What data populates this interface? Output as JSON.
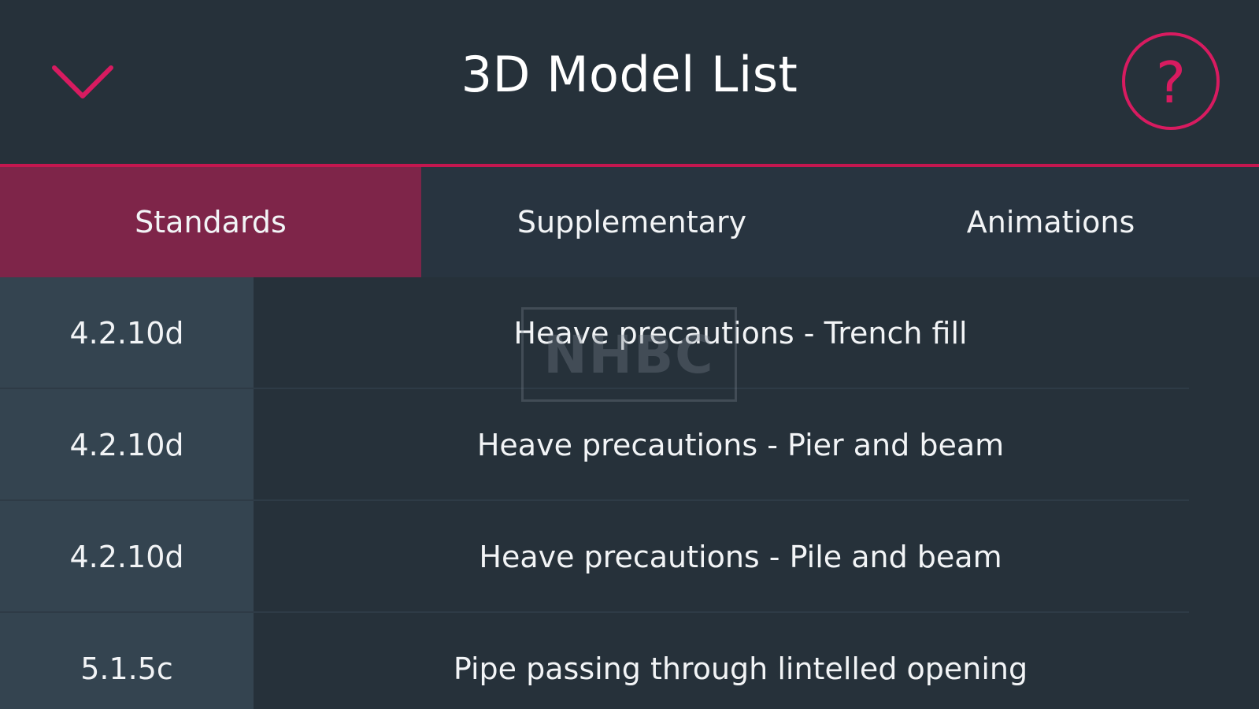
{
  "header": {
    "title": "3D Model List",
    "collapse_icon": "chevron-down-icon",
    "help_icon": "question-mark-icon",
    "help_label": "?"
  },
  "tabs": [
    {
      "label": "Standards",
      "active": true
    },
    {
      "label": "Supplementary",
      "active": false
    },
    {
      "label": "Animations",
      "active": false
    }
  ],
  "rows": [
    {
      "code": "4.2.10d",
      "title": "Heave precautions - Trench fill"
    },
    {
      "code": "4.2.10d",
      "title": "Heave precautions - Pier and beam"
    },
    {
      "code": "4.2.10d",
      "title": "Heave precautions - Pile and beam"
    },
    {
      "code": "5.1.5c",
      "title": "Pipe passing through lintelled opening"
    }
  ],
  "watermark": {
    "text": "NHBC"
  },
  "colors": {
    "background": "#26313a",
    "accent": "#d81b60",
    "active_tab": "#7e2549",
    "code_column": "#344450"
  }
}
